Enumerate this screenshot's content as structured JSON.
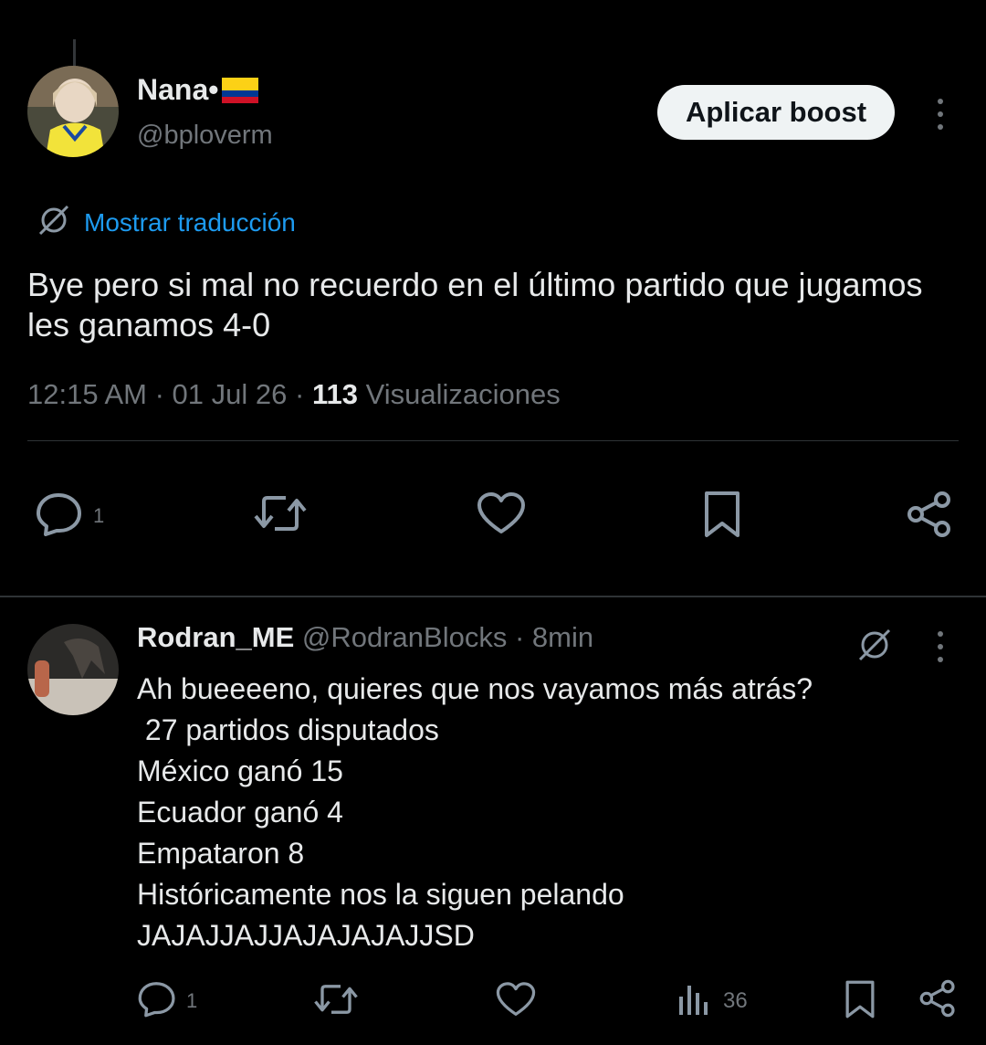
{
  "tweet": {
    "author_name": "Nana•",
    "author_flag": "🇨🇴",
    "author_handle": "@bploverm",
    "boost_label": "Aplicar boost",
    "translate_label": "Mostrar traducción",
    "text": "Bye pero si mal no recuerdo en el último partido que jugamos les ganamos 4-0",
    "time": "12:15 AM",
    "date": "01 Jul 26",
    "views_count": "113",
    "views_label": "Visualizaciones",
    "reply_count": "1",
    "icons": [
      "reply-icon",
      "retweet-icon",
      "like-icon",
      "bookmark-icon",
      "share-icon"
    ]
  },
  "reply": {
    "author_name": "Rodran_ME",
    "author_handle": "@RodranBlocks",
    "time_ago": "8min",
    "lines": [
      "Ah bueeeeno, quieres que nos vayamos más atrás?",
      " 27 partidos disputados",
      "México ganó 15",
      "Ecuador ganó 4",
      "Empataron 8",
      "Históricamente nos la siguen pelando",
      "JAJAJJAJJAJAJAJAJJSD"
    ],
    "reply_count": "1",
    "views_count": "36",
    "icons": [
      "reply-icon",
      "retweet-icon",
      "like-icon",
      "views-icon",
      "bookmark-icon",
      "share-icon"
    ]
  },
  "colors": {
    "background": "#000000",
    "text": "#e7e9ea",
    "muted": "#71767b",
    "link": "#1d9bf0",
    "divider": "#2f3336"
  }
}
